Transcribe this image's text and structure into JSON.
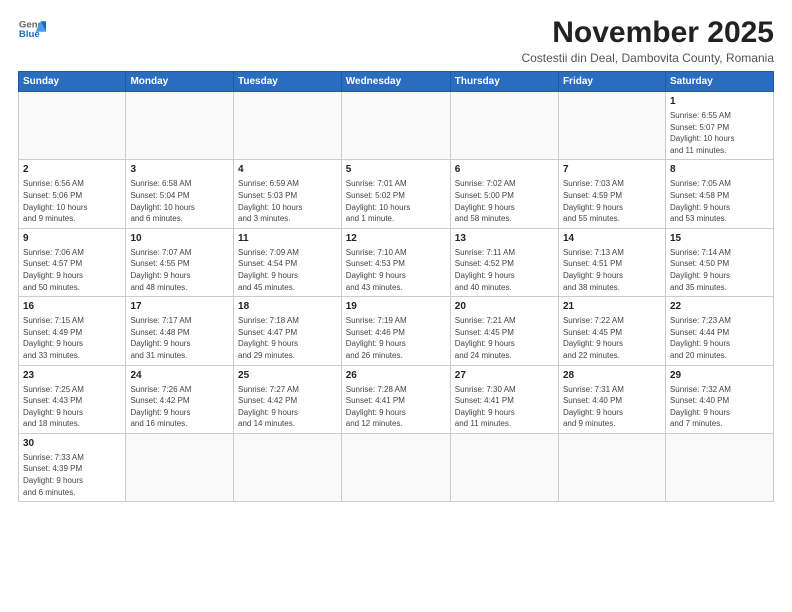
{
  "logo": {
    "general": "General",
    "blue": "Blue"
  },
  "title": "November 2025",
  "subtitle": "Costestii din Deal, Dambovita County, Romania",
  "days_header": [
    "Sunday",
    "Monday",
    "Tuesday",
    "Wednesday",
    "Thursday",
    "Friday",
    "Saturday"
  ],
  "weeks": [
    [
      {
        "day": "",
        "info": ""
      },
      {
        "day": "",
        "info": ""
      },
      {
        "day": "",
        "info": ""
      },
      {
        "day": "",
        "info": ""
      },
      {
        "day": "",
        "info": ""
      },
      {
        "day": "",
        "info": ""
      },
      {
        "day": "1",
        "info": "Sunrise: 6:55 AM\nSunset: 5:07 PM\nDaylight: 10 hours\nand 11 minutes."
      }
    ],
    [
      {
        "day": "2",
        "info": "Sunrise: 6:56 AM\nSunset: 5:06 PM\nDaylight: 10 hours\nand 9 minutes."
      },
      {
        "day": "3",
        "info": "Sunrise: 6:58 AM\nSunset: 5:04 PM\nDaylight: 10 hours\nand 6 minutes."
      },
      {
        "day": "4",
        "info": "Sunrise: 6:59 AM\nSunset: 5:03 PM\nDaylight: 10 hours\nand 3 minutes."
      },
      {
        "day": "5",
        "info": "Sunrise: 7:01 AM\nSunset: 5:02 PM\nDaylight: 10 hours\nand 1 minute."
      },
      {
        "day": "6",
        "info": "Sunrise: 7:02 AM\nSunset: 5:00 PM\nDaylight: 9 hours\nand 58 minutes."
      },
      {
        "day": "7",
        "info": "Sunrise: 7:03 AM\nSunset: 4:59 PM\nDaylight: 9 hours\nand 55 minutes."
      },
      {
        "day": "8",
        "info": "Sunrise: 7:05 AM\nSunset: 4:58 PM\nDaylight: 9 hours\nand 53 minutes."
      }
    ],
    [
      {
        "day": "9",
        "info": "Sunrise: 7:06 AM\nSunset: 4:57 PM\nDaylight: 9 hours\nand 50 minutes."
      },
      {
        "day": "10",
        "info": "Sunrise: 7:07 AM\nSunset: 4:55 PM\nDaylight: 9 hours\nand 48 minutes."
      },
      {
        "day": "11",
        "info": "Sunrise: 7:09 AM\nSunset: 4:54 PM\nDaylight: 9 hours\nand 45 minutes."
      },
      {
        "day": "12",
        "info": "Sunrise: 7:10 AM\nSunset: 4:53 PM\nDaylight: 9 hours\nand 43 minutes."
      },
      {
        "day": "13",
        "info": "Sunrise: 7:11 AM\nSunset: 4:52 PM\nDaylight: 9 hours\nand 40 minutes."
      },
      {
        "day": "14",
        "info": "Sunrise: 7:13 AM\nSunset: 4:51 PM\nDaylight: 9 hours\nand 38 minutes."
      },
      {
        "day": "15",
        "info": "Sunrise: 7:14 AM\nSunset: 4:50 PM\nDaylight: 9 hours\nand 35 minutes."
      }
    ],
    [
      {
        "day": "16",
        "info": "Sunrise: 7:15 AM\nSunset: 4:49 PM\nDaylight: 9 hours\nand 33 minutes."
      },
      {
        "day": "17",
        "info": "Sunrise: 7:17 AM\nSunset: 4:48 PM\nDaylight: 9 hours\nand 31 minutes."
      },
      {
        "day": "18",
        "info": "Sunrise: 7:18 AM\nSunset: 4:47 PM\nDaylight: 9 hours\nand 29 minutes."
      },
      {
        "day": "19",
        "info": "Sunrise: 7:19 AM\nSunset: 4:46 PM\nDaylight: 9 hours\nand 26 minutes."
      },
      {
        "day": "20",
        "info": "Sunrise: 7:21 AM\nSunset: 4:45 PM\nDaylight: 9 hours\nand 24 minutes."
      },
      {
        "day": "21",
        "info": "Sunrise: 7:22 AM\nSunset: 4:45 PM\nDaylight: 9 hours\nand 22 minutes."
      },
      {
        "day": "22",
        "info": "Sunrise: 7:23 AM\nSunset: 4:44 PM\nDaylight: 9 hours\nand 20 minutes."
      }
    ],
    [
      {
        "day": "23",
        "info": "Sunrise: 7:25 AM\nSunset: 4:43 PM\nDaylight: 9 hours\nand 18 minutes."
      },
      {
        "day": "24",
        "info": "Sunrise: 7:26 AM\nSunset: 4:42 PM\nDaylight: 9 hours\nand 16 minutes."
      },
      {
        "day": "25",
        "info": "Sunrise: 7:27 AM\nSunset: 4:42 PM\nDaylight: 9 hours\nand 14 minutes."
      },
      {
        "day": "26",
        "info": "Sunrise: 7:28 AM\nSunset: 4:41 PM\nDaylight: 9 hours\nand 12 minutes."
      },
      {
        "day": "27",
        "info": "Sunrise: 7:30 AM\nSunset: 4:41 PM\nDaylight: 9 hours\nand 11 minutes."
      },
      {
        "day": "28",
        "info": "Sunrise: 7:31 AM\nSunset: 4:40 PM\nDaylight: 9 hours\nand 9 minutes."
      },
      {
        "day": "29",
        "info": "Sunrise: 7:32 AM\nSunset: 4:40 PM\nDaylight: 9 hours\nand 7 minutes."
      }
    ],
    [
      {
        "day": "30",
        "info": "Sunrise: 7:33 AM\nSunset: 4:39 PM\nDaylight: 9 hours\nand 6 minutes."
      },
      {
        "day": "",
        "info": ""
      },
      {
        "day": "",
        "info": ""
      },
      {
        "day": "",
        "info": ""
      },
      {
        "day": "",
        "info": ""
      },
      {
        "day": "",
        "info": ""
      },
      {
        "day": "",
        "info": ""
      }
    ]
  ]
}
